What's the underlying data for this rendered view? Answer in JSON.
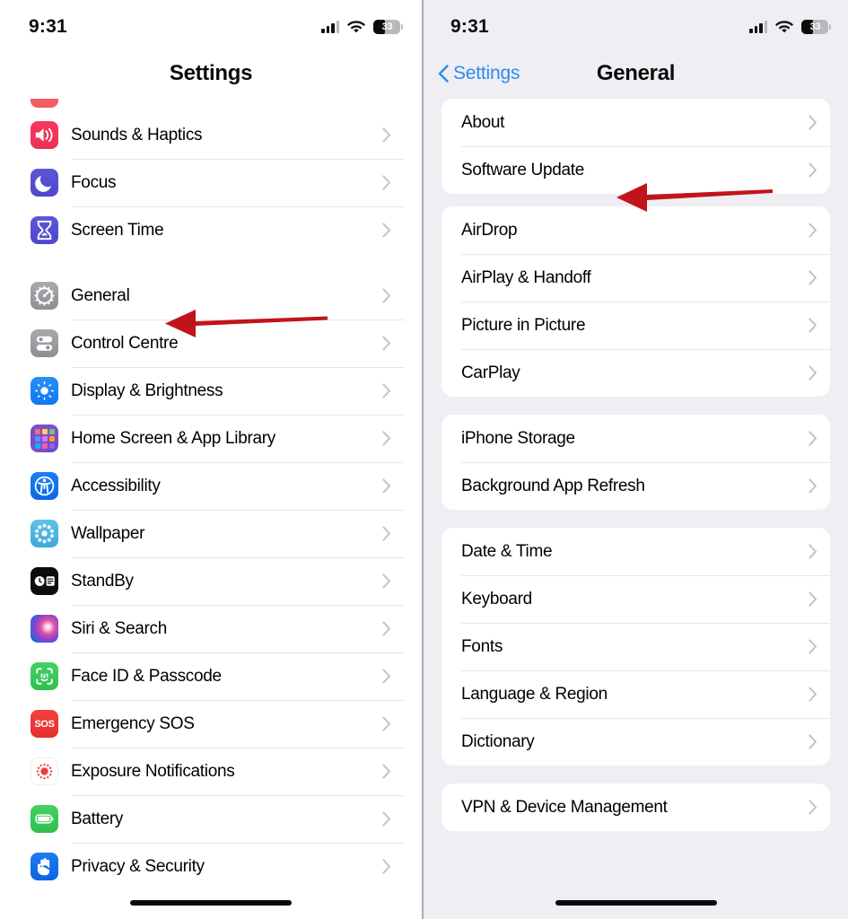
{
  "status_bar": {
    "time": "9:31",
    "battery_level": "33",
    "cellular_icon": "cellular-signal-icon",
    "wifi_icon": "wifi-icon",
    "battery_icon": "battery-icon"
  },
  "left_panel": {
    "nav_title": "Settings",
    "partial_row_above": "notifications",
    "groups": [
      {
        "id": "group-media",
        "partial_top": true,
        "rows": [
          {
            "label": "Sounds & Haptics",
            "icon": "speaker-icon",
            "icon_class": "ico-sounds"
          },
          {
            "label": "Focus",
            "icon": "moon-icon",
            "icon_class": "ico-focus"
          },
          {
            "label": "Screen Time",
            "icon": "hourglass-icon",
            "icon_class": "ico-screen"
          }
        ]
      },
      {
        "id": "group-system",
        "partial_top": false,
        "rows": [
          {
            "label": "General",
            "icon": "gear-icon",
            "icon_class": "ico-general"
          },
          {
            "label": "Control Centre",
            "icon": "sliders-icon",
            "icon_class": "ico-control"
          },
          {
            "label": "Display & Brightness",
            "icon": "brightness-icon",
            "icon_class": "ico-display"
          },
          {
            "label": "Home Screen & App Library",
            "icon": "app-grid-icon",
            "icon_class": "ico-home"
          },
          {
            "label": "Accessibility",
            "icon": "accessibility-icon",
            "icon_class": "ico-access"
          },
          {
            "label": "Wallpaper",
            "icon": "wallpaper-icon",
            "icon_class": "ico-wall"
          },
          {
            "label": "StandBy",
            "icon": "standby-icon",
            "icon_class": "ico-standby"
          },
          {
            "label": "Siri & Search",
            "icon": "siri-icon",
            "icon_class": "ico-siri"
          },
          {
            "label": "Face ID & Passcode",
            "icon": "face-id-icon",
            "icon_class": "ico-faceid"
          },
          {
            "label": "Emergency SOS",
            "icon": "sos-icon",
            "icon_class": "ico-sos"
          },
          {
            "label": "Exposure Notifications",
            "icon": "exposure-icon",
            "icon_class": "ico-exposure"
          },
          {
            "label": "Battery",
            "icon": "battery-icon",
            "icon_class": "ico-battery"
          },
          {
            "label": "Privacy & Security",
            "icon": "hand-icon",
            "icon_class": "ico-privacy"
          }
        ]
      }
    ]
  },
  "right_panel": {
    "back_label": "Settings",
    "nav_title": "General",
    "back_icon": "chevron-left-icon",
    "groups": [
      {
        "id": "group-about",
        "rows": [
          {
            "label": "About"
          },
          {
            "label": "Software Update"
          }
        ]
      },
      {
        "id": "group-connectivity",
        "rows": [
          {
            "label": "AirDrop"
          },
          {
            "label": "AirPlay & Handoff"
          },
          {
            "label": "Picture in Picture"
          },
          {
            "label": "CarPlay"
          }
        ]
      },
      {
        "id": "group-storage",
        "rows": [
          {
            "label": "iPhone Storage"
          },
          {
            "label": "Background App Refresh"
          }
        ]
      },
      {
        "id": "group-localization",
        "rows": [
          {
            "label": "Date & Time"
          },
          {
            "label": "Keyboard"
          },
          {
            "label": "Fonts"
          },
          {
            "label": "Language & Region"
          },
          {
            "label": "Dictionary"
          }
        ]
      },
      {
        "id": "group-management",
        "rows": [
          {
            "label": "VPN & Device Management"
          }
        ]
      }
    ]
  },
  "annotations": [
    {
      "name": "arrow-pointing-to-general",
      "target": "General",
      "color": "#c1141a",
      "direction": "left"
    },
    {
      "name": "arrow-pointing-to-software-update",
      "target": "Software Update",
      "color": "#c1141a",
      "direction": "left"
    }
  ],
  "colors": {
    "accent_blue": "#2d8bf2",
    "annotation_red": "#c1141a",
    "panel_bg_right": "#eeeef3",
    "panel_bg_left": "#ffffff",
    "row_bg": "#ffffff",
    "separator": "#e6e6e8",
    "chevron": "#c3c3c7"
  },
  "chevron_icon": "chevron-right-icon",
  "home_indicator": "home-indicator"
}
